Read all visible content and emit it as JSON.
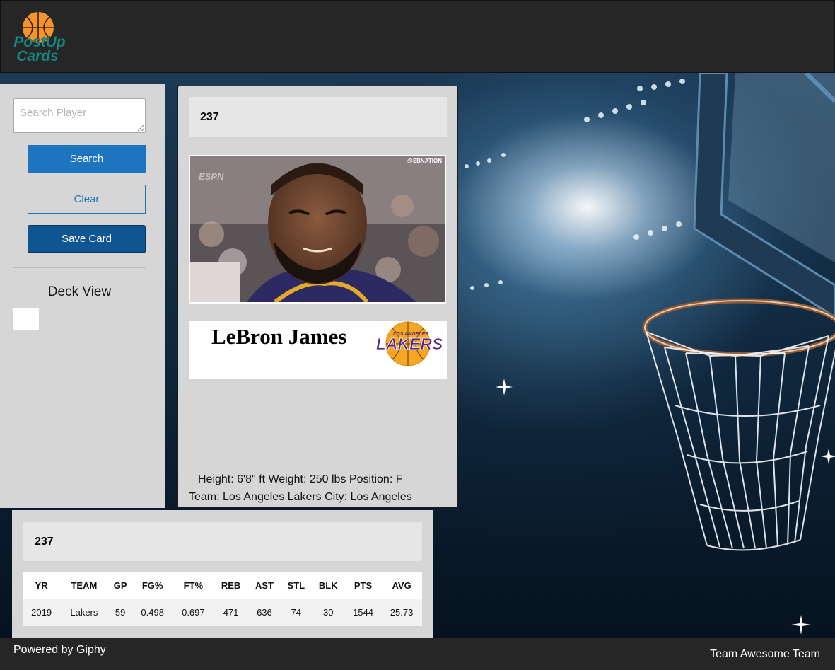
{
  "header": {
    "logo_text_line1": "PostUp",
    "logo_text_line2": "Cards"
  },
  "sidebar": {
    "search_placeholder": "Search Player",
    "search_label": "Search",
    "clear_label": "Clear",
    "save_label": "Save Card",
    "deck_title": "Deck View"
  },
  "card": {
    "player_id": "237",
    "gif_watermark_left": "ESPN",
    "gif_watermark_right": "@SBNATION",
    "player_name": "LeBron James",
    "team_logo_text_top": "LOS ANGELES",
    "team_logo_text_main": "LAKERS",
    "bio_line1": "Height: 6'8\" ft Weight: 250 lbs Position: F",
    "bio_line2": "Team: Los Angeles Lakers City: Los Angeles"
  },
  "stats": {
    "player_id": "237",
    "columns": [
      "YR",
      "TEAM",
      "GP",
      "FG%",
      "FT%",
      "REB",
      "AST",
      "STL",
      "BLK",
      "PTS",
      "AVG"
    ],
    "rows": [
      [
        "2019",
        "Lakers",
        "59",
        "0.498",
        "0.697",
        "471",
        "636",
        "74",
        "30",
        "1544",
        "25.73"
      ]
    ]
  },
  "footer": {
    "left": "Powered by Giphy",
    "right": "Team Awesome Team"
  },
  "colors": {
    "header_bg": "#262626",
    "panel_bg": "#d6d6d6",
    "primary": "#1f74c0",
    "save": "#0f5592",
    "lakers_gold": "#f5a623",
    "lakers_purple": "#552583"
  }
}
